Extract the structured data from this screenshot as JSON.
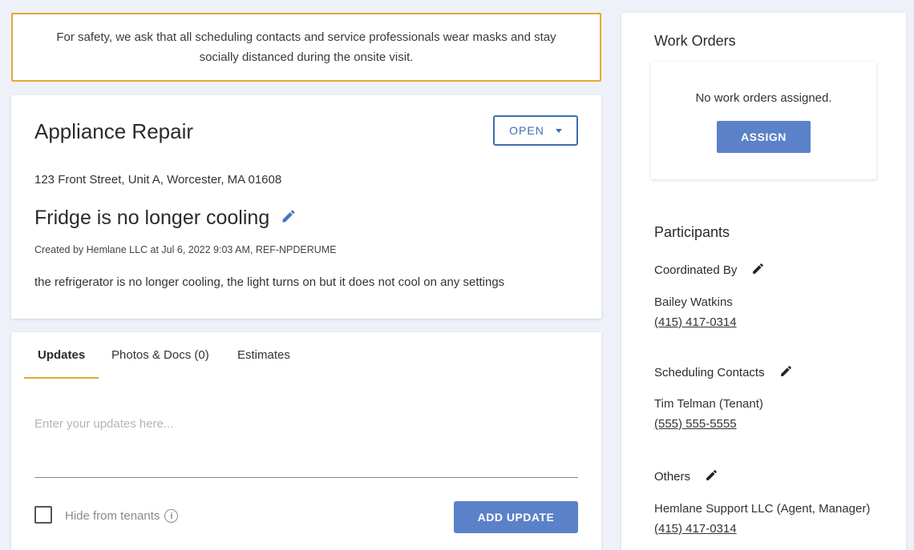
{
  "banner": {
    "text": "For safety, we ask that all scheduling contacts and service professionals wear masks and stay socially distanced during the onsite visit."
  },
  "job": {
    "title": "Appliance Repair",
    "status": "OPEN",
    "address": "123 Front Street, Unit A, Worcester, MA 01608",
    "issue": "Fridge is no longer cooling",
    "meta": "Created by Hemlane LLC at Jul 6, 2022 9:03 AM, REF-NPDERUME",
    "description": "the refrigerator is no longer cooling, the light turns on but it does not cool on any settings"
  },
  "tabs": {
    "updates": "Updates",
    "photos": "Photos & Docs (0)",
    "estimates": "Estimates"
  },
  "updates": {
    "placeholder": "Enter your updates here...",
    "hide_label": "Hide from tenants",
    "add_button": "ADD UPDATE"
  },
  "work_orders": {
    "title": "Work Orders",
    "empty": "No work orders assigned.",
    "assign_button": "ASSIGN"
  },
  "participants": {
    "title": "Participants",
    "coordinated_by": {
      "label": "Coordinated By",
      "name": "Bailey Watkins",
      "phone": "(415) 417-0314"
    },
    "scheduling": {
      "label": "Scheduling Contacts",
      "name": "Tim Telman (Tenant)",
      "phone": "(555) 555-5555"
    },
    "others": {
      "label": "Others",
      "name": "Hemlane Support LLC (Agent, Manager)",
      "phone": "(415) 417-0314"
    }
  },
  "colors": {
    "accent": "#5b81c8",
    "banner_border": "#e3a936",
    "status_border": "#3f6db4"
  }
}
